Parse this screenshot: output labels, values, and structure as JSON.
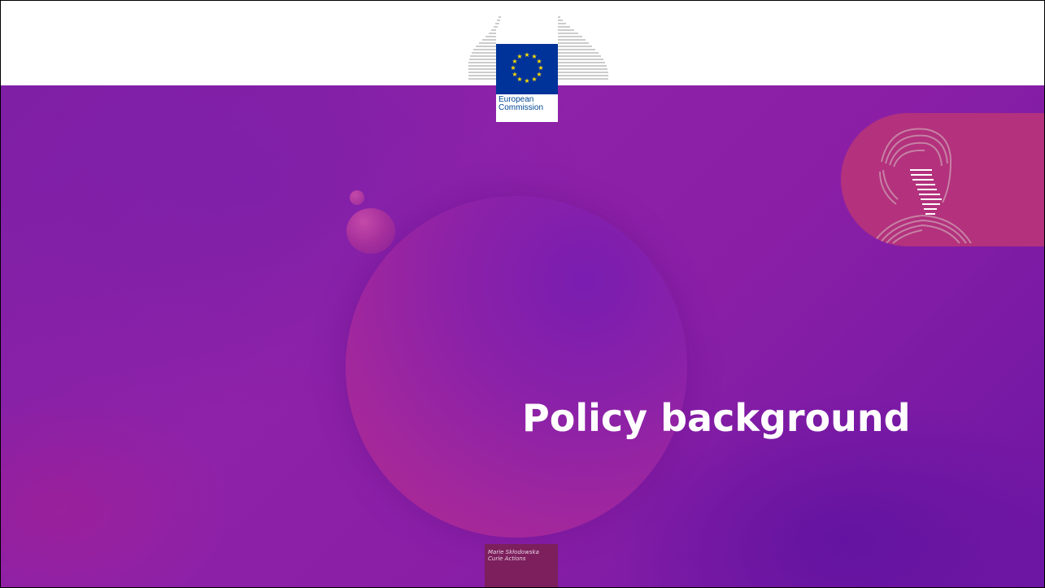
{
  "slide": {
    "title": "Policy background",
    "colors": {
      "hero_purple": "#8e22a8",
      "pill_magenta": "#b3317d",
      "footer_box": "#7c1f5c",
      "eu_blue": "#003399",
      "eu_star": "#ffdd00"
    }
  },
  "logo": {
    "line1": "European",
    "line2": "Commission",
    "icon": "eu-flag-icon"
  },
  "footer": {
    "line1": "Marie Skłodowska",
    "line2": "Curie Actions"
  },
  "portrait": {
    "icon": "fingerprint-portrait-icon"
  }
}
